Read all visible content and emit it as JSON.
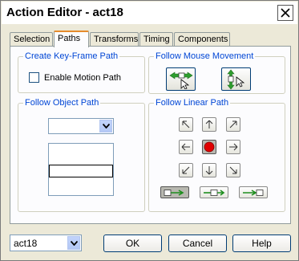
{
  "window": {
    "title": "Action Editor - act18"
  },
  "tabs": [
    {
      "label": "Selection"
    },
    {
      "label": "Paths"
    },
    {
      "label": "Transforms"
    },
    {
      "label": "Timing"
    },
    {
      "label": "Components"
    }
  ],
  "active_tab": "Paths",
  "groups": {
    "keyframe": {
      "title": "Create Key-Frame Path",
      "checkbox_label": "Enable Motion Path",
      "checked": false
    },
    "mouse": {
      "title": "Follow Mouse Movement"
    },
    "object": {
      "title": "Follow Object Path",
      "combo_value": ""
    },
    "linear": {
      "title": "Follow Linear Path"
    }
  },
  "footer": {
    "object_select": "act18",
    "ok_label": "OK",
    "cancel_label": "Cancel",
    "help_label": "Help"
  },
  "colors": {
    "group_title": "#0046d5",
    "accent_tab": "#e68b2c",
    "stop_red": "#e00000",
    "arrow_green": "#2e9e2e"
  }
}
